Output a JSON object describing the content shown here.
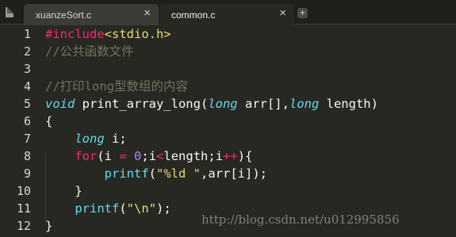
{
  "tabs": [
    {
      "label": "xuanzeSort.c",
      "close": "×"
    },
    {
      "label": "common.c",
      "close": "×"
    }
  ],
  "new_tab_label": "+",
  "line_numbers": [
    "1",
    "2",
    "3",
    "4",
    "5",
    "6",
    "7",
    "8",
    "9",
    "10",
    "11",
    "12"
  ],
  "code": {
    "l1": {
      "dir": "#include",
      "hdr": "<stdio.h>"
    },
    "l2": {
      "comment": "//公共函数文件"
    },
    "l4": {
      "comment": "//打印long型数组的内容"
    },
    "l5": {
      "t1": "void",
      "name": " print_array_long(",
      "t2": "long",
      "p1": " arr[],",
      "t3": "long",
      "p2": " length)"
    },
    "l6": {
      "text": "{"
    },
    "l7": {
      "indent": "    ",
      "t": "long",
      "rest": " i;"
    },
    "l8": {
      "indent": "    ",
      "kw": "for",
      "a": "(i ",
      "op1": "=",
      "b": " ",
      "num": "0",
      "c": ";i",
      "op2": "<",
      "d": "length;i",
      "op3": "++",
      "e": "){"
    },
    "l9": {
      "indent": "        ",
      "fn": "printf",
      "a": "(",
      "str": "\"%ld \"",
      "rest": ",arr[i]);"
    },
    "l10": {
      "indent": "    ",
      "text": "}"
    },
    "l11": {
      "indent": "    ",
      "fn": "printf",
      "a": "(",
      "str": "\"\\n\"",
      "rest": ");"
    },
    "l12": {
      "text": "}"
    }
  },
  "watermark": "http://blog.csdn.net/u012995856",
  "colors": {
    "background": "#272822",
    "keyword": "#f92672",
    "type": "#66d9ef",
    "comment": "#75715e",
    "string": "#e6db74",
    "number": "#ae81ff"
  }
}
